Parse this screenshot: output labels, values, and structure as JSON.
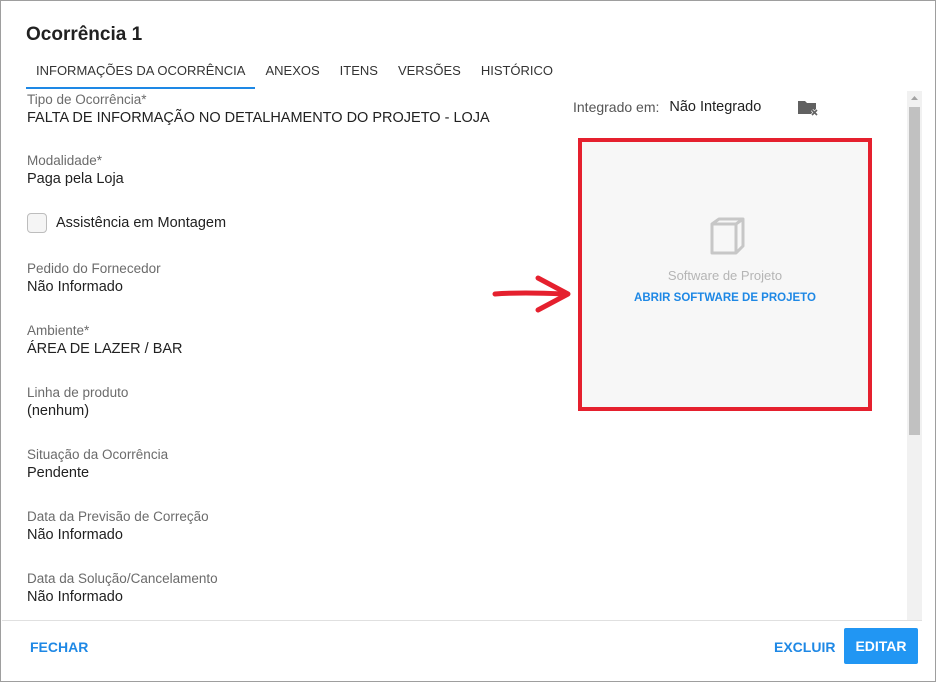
{
  "dialog": {
    "title": "Ocorrência 1"
  },
  "tabs": [
    {
      "label": "INFORMAÇÕES DA OCORRÊNCIA",
      "active": true
    },
    {
      "label": "ANEXOS"
    },
    {
      "label": "ITENS"
    },
    {
      "label": "VERSÕES"
    },
    {
      "label": "HISTÓRICO"
    }
  ],
  "fields": {
    "tipo": {
      "label": "Tipo de Ocorrência*",
      "value": "FALTA DE INFORMAÇÃO NO DETALHAMENTO DO PROJETO - LOJA"
    },
    "modalidade": {
      "label": "Modalidade*",
      "value": "Paga pela Loja"
    },
    "assistencia": {
      "label": "Assistência em Montagem",
      "checked": false
    },
    "pedido": {
      "label": "Pedido do Fornecedor",
      "value": "Não Informado"
    },
    "ambiente": {
      "label": "Ambiente*",
      "value": "ÁREA DE LAZER / BAR"
    },
    "linha": {
      "label": "Linha de produto",
      "value": "(nenhum)"
    },
    "situacao": {
      "label": "Situação da Ocorrência",
      "value": "Pendente"
    },
    "previsao": {
      "label": "Data da Previsão de Correção",
      "value": "Não Informado"
    },
    "solucao": {
      "label": "Data da Solução/Cancelamento",
      "value": "Não Informado"
    }
  },
  "integration": {
    "label": "Integrado em:",
    "value": "Não Integrado",
    "icon": "folder-remove-icon"
  },
  "software": {
    "title": "Software de Projeto",
    "link": "ABRIR SOFTWARE DE PROJETO",
    "icon": "cube-icon",
    "highlight_color": "#e5202e"
  },
  "footer": {
    "close": "FECHAR",
    "delete": "EXCLUIR",
    "edit": "EDITAR"
  },
  "colors": {
    "accent": "#2196f3",
    "link": "#1e88e5",
    "annotation": "#e5202e"
  }
}
